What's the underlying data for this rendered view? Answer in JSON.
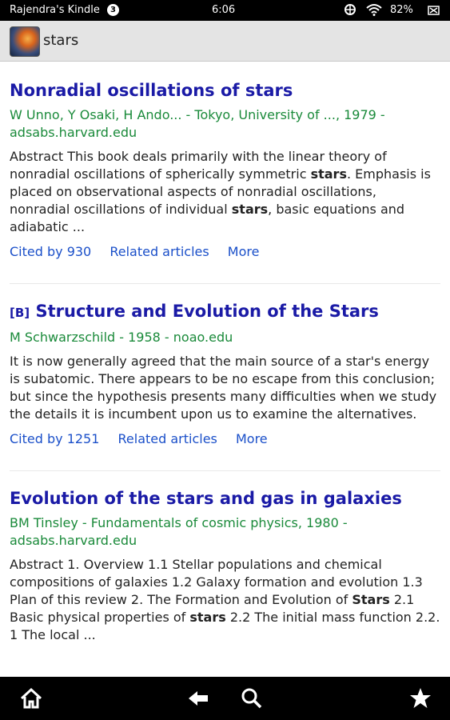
{
  "status": {
    "device_name": "Rajendra's Kindle",
    "notification_count": "3",
    "time": "6:06",
    "battery": "82%"
  },
  "appbar": {
    "query": "stars"
  },
  "results": [
    {
      "title_parts": [
        "Nonradial oscillations of ",
        "stars"
      ],
      "meta_line1": "W Unno, Y Osaki, H Ando... - Tokyo, University of ..., 1979 -",
      "meta_line2": "adsabs.harvard.edu",
      "snippet_parts": [
        "Abstract This book deals primarily with the linear theory of nonradial oscillations of spherically symmetric ",
        "stars",
        ". Emphasis is placed on observational aspects of nonradial oscillations, nonradial oscillations of individual ",
        "stars",
        ", basic equations and adiabatic ..."
      ],
      "cited_by": "Cited by 930",
      "related": "Related articles",
      "more": "More"
    },
    {
      "tag": "[B]",
      "title_parts": [
        "Structure and Evolution of the ",
        "Stars"
      ],
      "meta_line1": "M Schwarzschild - 1958 - noao.edu",
      "snippet": "It is now generally agreed that the main source of a star's energy is subatomic. There appears to be no escape from this conclusion; but since the hypothesis presents many difficulties when we study the details it is incumbent upon us to examine the alternatives.",
      "cited_by": "Cited by 1251",
      "related": "Related articles",
      "more": "More"
    },
    {
      "title_parts": [
        "Evolution of the ",
        "stars",
        " and gas in galaxies"
      ],
      "meta_line1": "BM Tinsley - Fundamentals of cosmic physics, 1980 -",
      "meta_line2": "adsabs.harvard.edu",
      "snippet_parts": [
        "Abstract 1. Overview 1.1 Stellar populations and chemical compositions of galaxies 1.2 Galaxy formation and evolution 1.3 Plan of this review 2. The Formation and Evolution of ",
        "Stars",
        " 2.1 Basic physical properties of ",
        "stars",
        " 2.2 The initial mass function 2.2. 1 The local ..."
      ]
    }
  ],
  "navbar": {
    "icons": [
      "home-icon",
      "back-icon",
      "search-icon",
      "star-icon"
    ]
  }
}
